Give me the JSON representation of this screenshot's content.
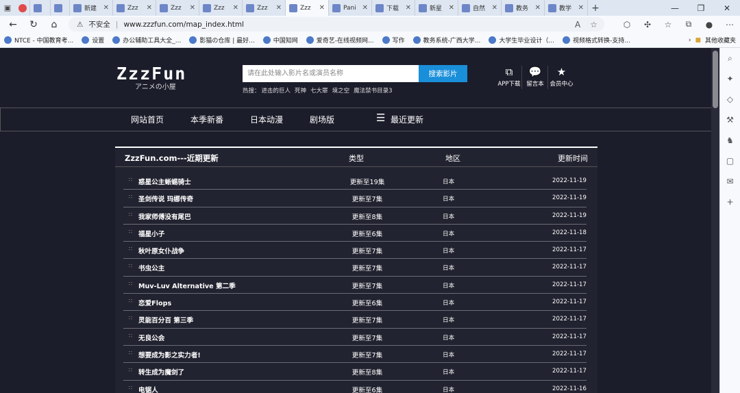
{
  "browser": {
    "tabs": [
      {
        "label": ""
      },
      {
        "label": ""
      },
      {
        "label": ""
      },
      {
        "label": "新建"
      },
      {
        "label": "Zzz"
      },
      {
        "label": "Zzz"
      },
      {
        "label": "Zzz"
      },
      {
        "label": "Zzz"
      },
      {
        "label": "Zzz",
        "active": true
      },
      {
        "label": "Pani"
      },
      {
        "label": "下载"
      },
      {
        "label": "新星"
      },
      {
        "label": "自然"
      },
      {
        "label": "教务"
      },
      {
        "label": "教学"
      }
    ],
    "security_label": "不安全",
    "url": "www.zzzfun.com/map_index.html",
    "bookmarks": [
      "NTCE - 中国教育考...",
      "设置",
      "办公辅助工具大全_...",
      "影猫の仓库 | 最好...",
      "中国知网",
      "爱奇艺-在线视频网...",
      "写作",
      "教务系统-广西大学...",
      "大学生毕业设计（...",
      "视频格式转换-支持..."
    ],
    "other_bookmarks": "其他收藏夹"
  },
  "site": {
    "logo_text": "ZzzFun",
    "logo_sub": "アニメの小屋",
    "search_placeholder": "请在此处输入影片名或演员名称",
    "search_button": "搜索影片",
    "hot_label": "热搜：",
    "hot_items": [
      "进击的巨人",
      "死神",
      "七大罪",
      "境之空",
      "魔法禁书目录3"
    ],
    "tools": [
      {
        "icon": "⧉",
        "label": "APP下载"
      },
      {
        "icon": "💬",
        "label": "留言本"
      },
      {
        "icon": "★",
        "label": "会员中心"
      }
    ],
    "nav": [
      "网站首页",
      "本季新番",
      "日本动漫",
      "剧场版",
      "最近更新"
    ]
  },
  "table": {
    "title": "ZzzFun.com---近期更新",
    "col_type": "类型",
    "col_region": "地区",
    "col_time": "更新时间",
    "rows": [
      {
        "title": "惑星公主蜥蜴骑士",
        "status": "更新至19集",
        "region": "日本",
        "date": "2022-11-19"
      },
      {
        "title": "圣剑传说 玛娜传奇",
        "status": "更新至7集",
        "region": "日本",
        "date": "2022-11-19"
      },
      {
        "title": "我家师傅没有尾巴",
        "status": "更新至8集",
        "region": "日本",
        "date": "2022-11-19"
      },
      {
        "title": "福星小子",
        "status": "更新至6集",
        "region": "日本",
        "date": "2022-11-18"
      },
      {
        "title": "秋叶原女仆战争",
        "status": "更新至7集",
        "region": "日本",
        "date": "2022-11-17"
      },
      {
        "title": "书虫公主",
        "status": "更新至7集",
        "region": "日本",
        "date": "2022-11-17"
      },
      {
        "title": "Muv-Luv Alternative 第二季",
        "status": "更新至7集",
        "region": "日本",
        "date": "2022-11-17"
      },
      {
        "title": "恋爱Flops",
        "status": "更新至6集",
        "region": "日本",
        "date": "2022-11-17"
      },
      {
        "title": "灵能百分百 第三季",
        "status": "更新至7集",
        "region": "日本",
        "date": "2022-11-17"
      },
      {
        "title": "无良公会",
        "status": "更新至7集",
        "region": "日本",
        "date": "2022-11-17"
      },
      {
        "title": "想要成为影之实力者!",
        "status": "更新至7集",
        "region": "日本",
        "date": "2022-11-17"
      },
      {
        "title": "转生成为魔剑了",
        "status": "更新至8集",
        "region": "日本",
        "date": "2022-11-17"
      },
      {
        "title": "电锯人",
        "status": "更新至6集",
        "region": "日本",
        "date": "2022-11-16"
      }
    ]
  }
}
